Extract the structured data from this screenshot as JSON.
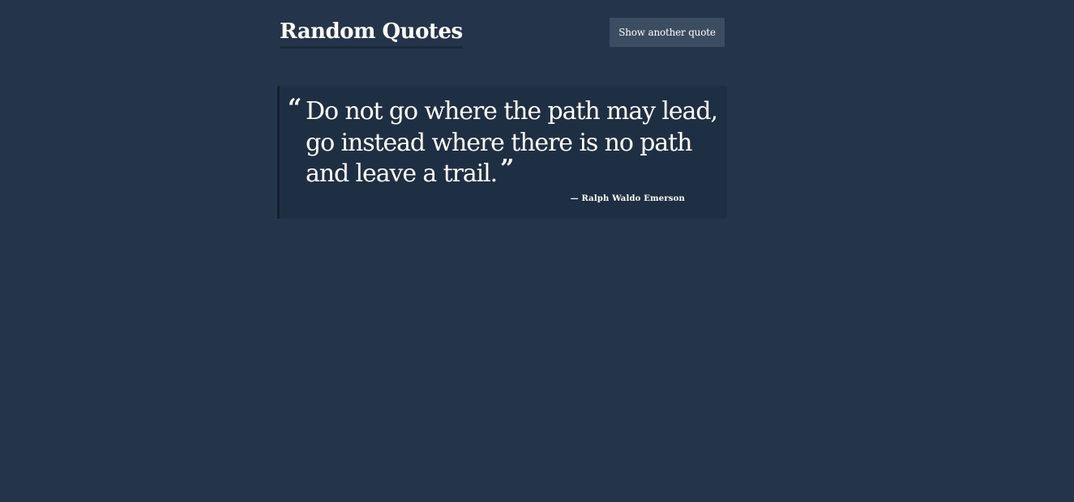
{
  "header": {
    "title": "Random Quotes",
    "button_label": "Show another quote"
  },
  "quote": {
    "open_mark": "“",
    "text": "Do not go where the path may lead, go instead where there is no path and leave a trail.",
    "close_mark": "”",
    "author": "— Ralph Waldo Emerson"
  },
  "colors": {
    "background": "#24344b",
    "card": "#1f2f43",
    "button": "#3c4c61",
    "text": "#ffffff"
  }
}
